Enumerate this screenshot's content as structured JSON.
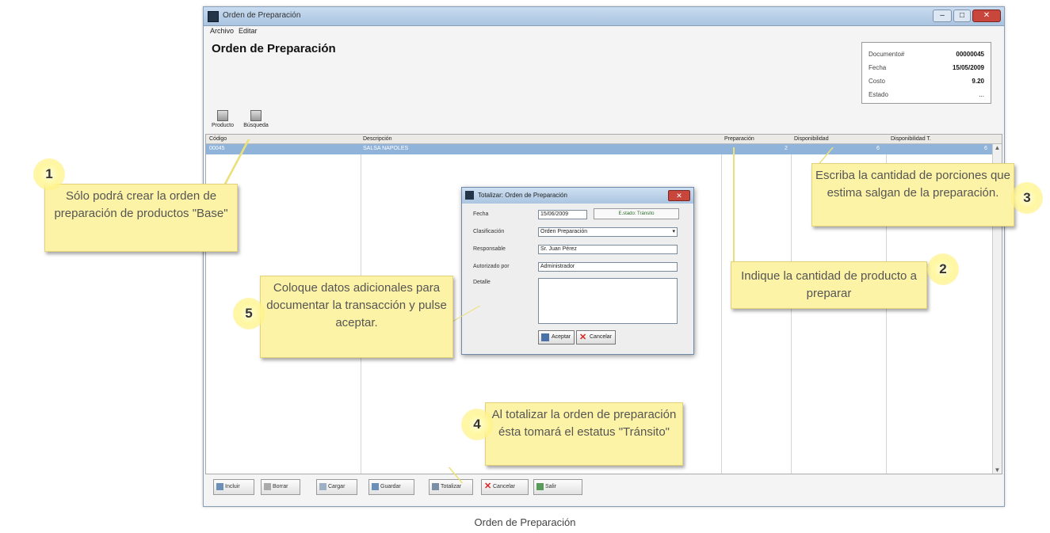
{
  "window": {
    "title": "Orden de Preparación",
    "menu": [
      "Archivo",
      "Editar"
    ],
    "heading": "Orden de Preparación",
    "controls": {
      "minimize": "–",
      "maximize": "□",
      "close": "✕"
    }
  },
  "doc_info": [
    {
      "label": "Documento#",
      "value": "00000045"
    },
    {
      "label": "Fecha",
      "value": "15/05/2009"
    },
    {
      "label": "Costo",
      "value": "9.20"
    },
    {
      "label": "Estado",
      "value": "..."
    }
  ],
  "toolbar": {
    "items": [
      {
        "label": "Producto",
        "icon": "product-icon"
      },
      {
        "label": "Búsqueda",
        "icon": "search-icon"
      }
    ]
  },
  "grid": {
    "columns": [
      "Código",
      "Descripción",
      "Preparación",
      "Disponibilidad",
      "Disponibilidad T."
    ],
    "selected_row": {
      "codigo": "00045",
      "descripcion": "SALSA NAPOLES",
      "preparacion": "2",
      "disponibilidad": "6",
      "disponibilidad_t": "6"
    }
  },
  "bottom_buttons": [
    {
      "label": "Incluir",
      "icon": "add-icon"
    },
    {
      "label": "Borrar",
      "icon": "delete-icon"
    },
    {
      "label": "Cargar",
      "icon": "load-icon"
    },
    {
      "label": "Guardar",
      "icon": "save-icon"
    },
    {
      "label": "Totalizar",
      "icon": "totalize-icon"
    },
    {
      "label": "Cancelar",
      "icon": "cancel-icon"
    },
    {
      "label": "Salir",
      "icon": "exit-icon"
    }
  ],
  "dialog": {
    "title": "Totalizar: Orden de Preparación",
    "status_badge": "E.stado: Tránsito",
    "fields": [
      {
        "label": "Fecha",
        "value": "15/06/2009"
      },
      {
        "label": "Clasificación",
        "value": "Orden Preparación"
      },
      {
        "label": "Responsable",
        "value": "Sr. Juan Pérez"
      },
      {
        "label": "Autorizado por",
        "value": "Administrador"
      },
      {
        "label": "Detalle",
        "value": ""
      }
    ],
    "accept_label": "Aceptar",
    "cancel_label": "Cancelar"
  },
  "callouts": [
    {
      "number": "1",
      "text": "Sólo podrá crear la orden de preparación de productos \"Base\""
    },
    {
      "number": "2",
      "text": "Indique la cantidad de producto a preparar"
    },
    {
      "number": "3",
      "text": "Escriba la cantidad de porciones que estima salgan de la preparación."
    },
    {
      "number": "4",
      "text": "Al totalizar la orden de preparación ésta tomará el estatus \"Tránsito\""
    },
    {
      "number": "5",
      "text": "Coloque datos adicionales para documentar la transacción y pulse aceptar."
    }
  ],
  "caption": "Orden de Preparación"
}
